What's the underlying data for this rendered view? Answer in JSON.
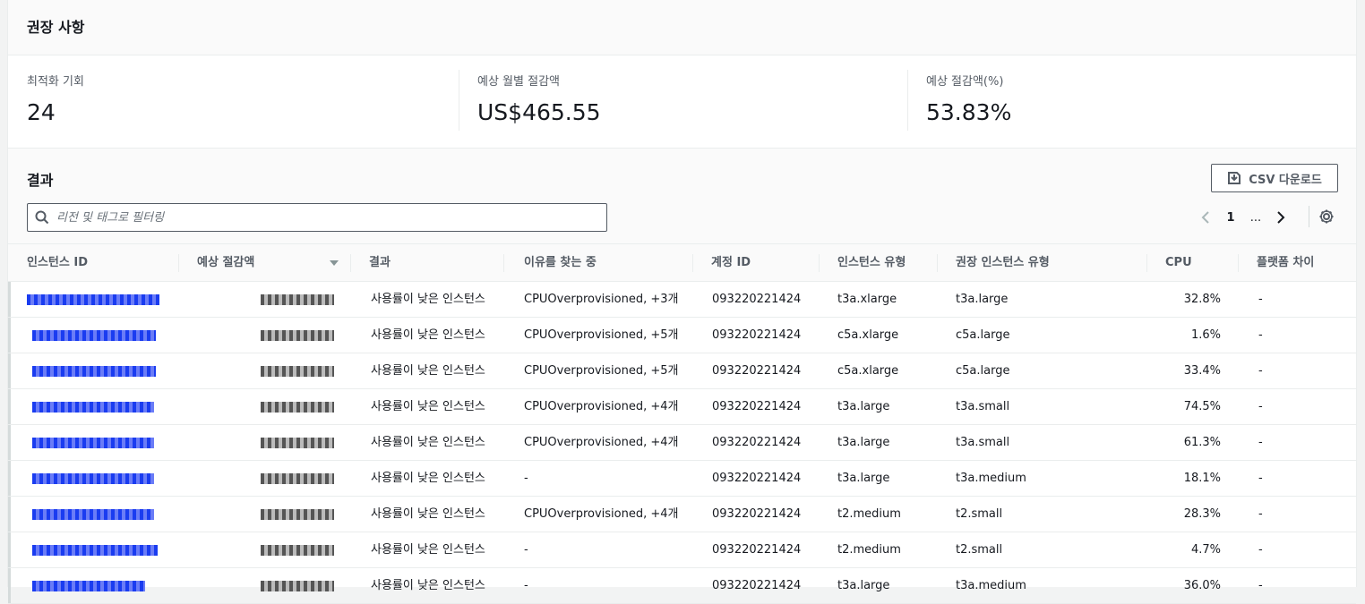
{
  "recommendations": {
    "title": "권장 사항"
  },
  "summary": [
    {
      "label": "최적화 기회",
      "value": "24"
    },
    {
      "label": "예상 월별 절감액",
      "value": "US$465.55"
    },
    {
      "label": "예상 절감액(%)",
      "value": "53.83%"
    }
  ],
  "results": {
    "title": "결과",
    "csv_label": "CSV 다운로드",
    "search_placeholder": "리전 및 태그로 필터링",
    "pagination": {
      "current": "1",
      "ellipsis": "..."
    }
  },
  "table": {
    "columns": [
      "인스턴스 ID",
      "예상 절감액",
      "결과",
      "이유를 찾는 중",
      "계정 ID",
      "인스턴스 유형",
      "권장 인스턴스 유형",
      "CPU",
      "플랫폼 차이"
    ],
    "rows": [
      {
        "finding": "사용률이 낮은 인스턴스",
        "reason": "CPUOverprovisioned, +3개",
        "account": "093220221424",
        "type": "t3a.xlarge",
        "rec_type": "t3a.large",
        "cpu": "32.8%",
        "platform": "-"
      },
      {
        "finding": "사용률이 낮은 인스턴스",
        "reason": "CPUOverprovisioned, +5개",
        "account": "093220221424",
        "type": "c5a.xlarge",
        "rec_type": "c5a.large",
        "cpu": "1.6%",
        "platform": "-"
      },
      {
        "finding": "사용률이 낮은 인스턴스",
        "reason": "CPUOverprovisioned, +5개",
        "account": "093220221424",
        "type": "c5a.xlarge",
        "rec_type": "c5a.large",
        "cpu": "33.4%",
        "platform": "-"
      },
      {
        "finding": "사용률이 낮은 인스턴스",
        "reason": "CPUOverprovisioned, +4개",
        "account": "093220221424",
        "type": "t3a.large",
        "rec_type": "t3a.small",
        "cpu": "74.5%",
        "platform": "-"
      },
      {
        "finding": "사용률이 낮은 인스턴스",
        "reason": "CPUOverprovisioned, +4개",
        "account": "093220221424",
        "type": "t3a.large",
        "rec_type": "t3a.small",
        "cpu": "61.3%",
        "platform": "-"
      },
      {
        "finding": "사용률이 낮은 인스턴스",
        "reason": "-",
        "account": "093220221424",
        "type": "t3a.large",
        "rec_type": "t3a.medium",
        "cpu": "18.1%",
        "platform": "-"
      },
      {
        "finding": "사용률이 낮은 인스턴스",
        "reason": "CPUOverprovisioned, +4개",
        "account": "093220221424",
        "type": "t2.medium",
        "rec_type": "t2.small",
        "cpu": "28.3%",
        "platform": "-"
      },
      {
        "finding": "사용률이 낮은 인스턴스",
        "reason": "-",
        "account": "093220221424",
        "type": "t2.medium",
        "rec_type": "t2.small",
        "cpu": "4.7%",
        "platform": "-"
      },
      {
        "finding": "사용률이 낮은 인스턴스",
        "reason": "-",
        "account": "093220221424",
        "type": "t3a.large",
        "rec_type": "t3a.medium",
        "cpu": "36.0%",
        "platform": "-"
      }
    ]
  },
  "colors": {
    "link": "#0000ee",
    "text": "#16191f",
    "muted": "#545b64"
  }
}
